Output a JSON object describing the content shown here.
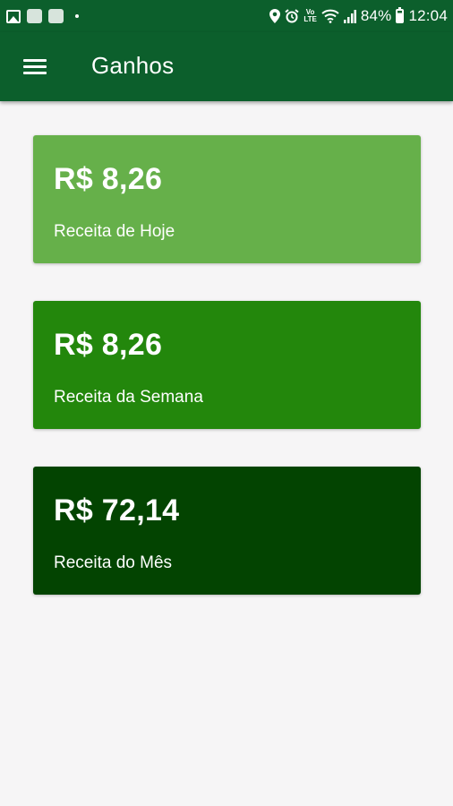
{
  "status_bar": {
    "battery": "84%",
    "time": "12:04",
    "icons": [
      "image-icon",
      "notification-square-icon",
      "notification-square-icon",
      "dot-icon",
      "location-icon",
      "alarm-icon",
      "volte-icon",
      "wifi-icon",
      "signal-icon",
      "battery-icon"
    ],
    "volte_top": "Vo",
    "volte_bottom": "LTE"
  },
  "toolbar": {
    "title": "Ganhos",
    "menu_icon": "hamburger-menu-icon",
    "color": "#0c5f2c"
  },
  "cards": [
    {
      "value": "R$ 8,26",
      "label": "Receita de Hoje",
      "color": "#66b04a"
    },
    {
      "value": "R$ 8,26",
      "label": "Receita da Semana",
      "color": "#23870c"
    },
    {
      "value": "R$ 72,14",
      "label": "Receita do Mês",
      "color": "#034401"
    }
  ],
  "background_color": "#f6f5f6"
}
